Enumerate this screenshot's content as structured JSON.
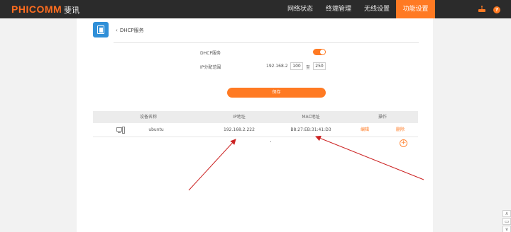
{
  "brand": {
    "name": "PHICOMM",
    "name_cn": "斐讯"
  },
  "nav": {
    "items": [
      {
        "label": "网络状态",
        "active": false
      },
      {
        "label": "终端管理",
        "active": false
      },
      {
        "label": "无线设置",
        "active": false
      },
      {
        "label": "功能设置",
        "active": true
      }
    ],
    "router_icon": "router-icon",
    "help_icon": "help-icon",
    "help_glyph": "?"
  },
  "page": {
    "service_icon": "dhcp-service-icon",
    "back_label": "DHCP服务",
    "back_glyph": "‹"
  },
  "form": {
    "dhcp_label": "DHCP服务",
    "dhcp_enabled": true,
    "ip_range_label": "IP分配范围",
    "ip_prefix": "192.168.2",
    "ip_start": "100",
    "ip_to": "至",
    "ip_end": "250"
  },
  "save_label": "保存",
  "table": {
    "headers": [
      "设备名称",
      "IP地址",
      "MAC地址",
      "操作"
    ],
    "rows": [
      {
        "icon": "computer-icon",
        "name": "ubuntu",
        "ip": "192.168.2.222",
        "mac": "B8:27:EB:31:41:D3",
        "edit": "编辑",
        "delete": "删除"
      }
    ],
    "add_glyph": "+"
  },
  "side_buttons": [
    "∧",
    "▭",
    "∨"
  ],
  "colors": {
    "accent": "#ff7a23",
    "annotation": "#cc2222",
    "topbar": "#2b2b2b",
    "icon_blue": "#2f8fd8"
  }
}
